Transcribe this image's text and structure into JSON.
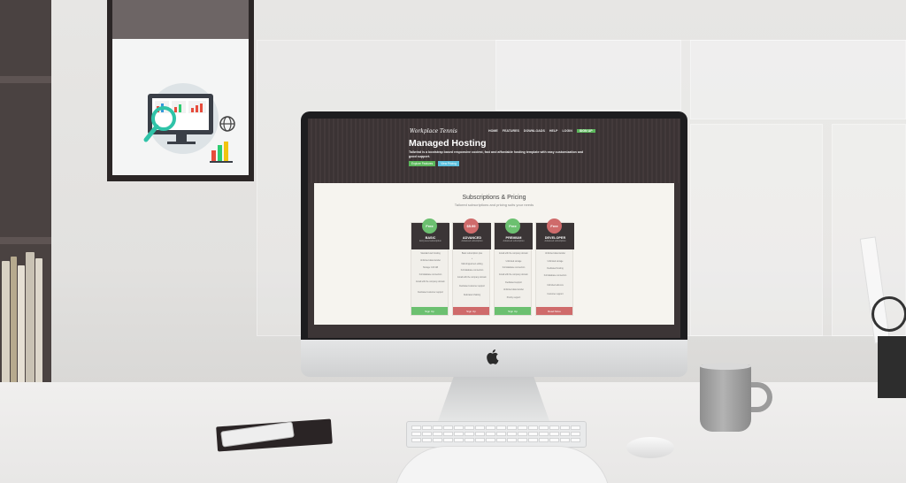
{
  "site": {
    "logo_text": "Workplace Tennis",
    "nav": [
      "HOME",
      "FEATURES",
      "DOWNLOADS",
      "HELP",
      "LOGIN",
      "SIGN UP"
    ],
    "hero_title": "Managed Hosting",
    "hero_subtitle": "Tailwind is a bootstrap based responsive coolest, fast and affordable hosting template with easy customization and good support.",
    "hero_buttons": [
      "Explore Features",
      "View Pricing"
    ],
    "pricing_title": "Subscriptions & Pricing",
    "pricing_subtitle": "Tailored subscriptions and pricing suits your needs",
    "plans": [
      {
        "price": "Free",
        "name": "BASIC",
        "desc": "Entry-level subscription",
        "features": [
          "Standard web hosting",
          "Unlimited data transfer",
          "Storage: 100 GB",
          "Full database connection",
          "Email with the company domain",
          "Dedicated customer support"
        ],
        "button": "Sign Up",
        "color": "#6cc070"
      },
      {
        "price": "$5.99",
        "name": "ADVANCED",
        "desc": "Advanced subscription",
        "features": [
          "Basic subscription plus",
          "+",
          "Multi-lingual text editing",
          "Full database connection",
          "Email with the company domain",
          "Dedicated customer support",
          "Dedicated chatting"
        ],
        "button": "Sign Up",
        "color": "#cf6b6b"
      },
      {
        "price": "Free",
        "name": "PREMIUM",
        "desc": "Advanced subscription",
        "features": [
          "Email with the company domain",
          "Unlimited storage",
          "Full database connection",
          "Email with the company domain",
          "Dedicated support",
          "Unlimited data transfer",
          "Priority support"
        ],
        "button": "Sign Up",
        "color": "#6cc070"
      },
      {
        "price": "Free",
        "name": "DEVELOPER",
        "desc": "Advanced subscription",
        "features": [
          "Unlimited data transfer",
          "Unlimited storage",
          "Dedicated hosting",
          "Full database connection",
          "Unlimited add-ons",
          "Customer support"
        ],
        "button": "Read More",
        "color": "#cf6b6b"
      }
    ]
  },
  "colors": {
    "green": "#6cc070",
    "red": "#cf6b6b",
    "dark": "#3b3536"
  },
  "icons": [
    "apple-logo-icon",
    "magnifier-analytics-icon",
    "globe-icon",
    "bar-chart-icon"
  ]
}
